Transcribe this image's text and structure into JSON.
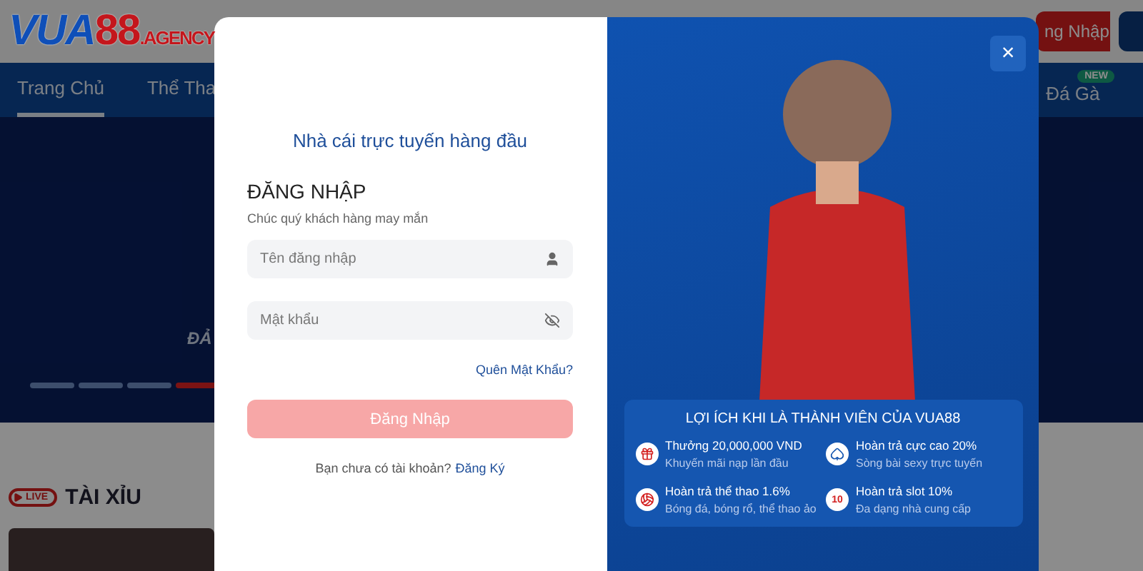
{
  "header": {
    "logo": {
      "brand": "VUA",
      "number": "88",
      "suffix": ".AGENCY"
    },
    "login_button": "ng Nhập"
  },
  "nav": {
    "tabs": [
      {
        "label": "Trang Chủ",
        "selected": true
      },
      {
        "label": "Thể Tha",
        "selected": false
      },
      {
        "label": "Đá Gà",
        "selected": false,
        "badge": "NEW"
      }
    ]
  },
  "banner": {
    "caption": "ĐẢ",
    "slides": [
      {
        "selected": false
      },
      {
        "selected": false
      },
      {
        "selected": false
      },
      {
        "selected": true
      }
    ]
  },
  "live_section": {
    "badge": "LIVE",
    "title": "TÀI XỈU"
  },
  "login_modal": {
    "tagline": "Nhà cái trực tuyến hàng đầu",
    "title": "ĐĂNG NHẬP",
    "subtitle": "Chúc quý khách hàng may mắn",
    "fields": [
      {
        "kind": "text",
        "placeholder": "Tên đăng nhập"
      },
      {
        "kind": "password",
        "placeholder": "Mật khẩu"
      }
    ],
    "forgot_link": "Quên Mật Khẩu?",
    "submit": {
      "label": "Đăng Nhập",
      "disabled": true
    },
    "signup_prompt": "Bạn chưa có tài khoản?",
    "signup_link": "Đăng Ký",
    "close": "×",
    "benefits_title": "LỢI ÍCH KHI LÀ THÀNH VIÊN CỦA VUA88",
    "benefits": [
      {
        "kind": "gift",
        "title": "Thưởng 20,000,000 VND",
        "text": "Khuyến mãi nạp lần đầu"
      },
      {
        "kind": "cards",
        "title": "Hoàn trả cực cao 20%",
        "text": "Sòng bài sexy trực tuyến"
      },
      {
        "kind": "sport",
        "title": "Hoàn trả thể thao 1.6%",
        "text": "Bóng đá, bóng rổ, thể thao ảo"
      },
      {
        "kind": "number",
        "badge": "10",
        "title": "Hoàn trả slot 10%",
        "text": "Đa dạng nhà cung cấp"
      }
    ]
  }
}
